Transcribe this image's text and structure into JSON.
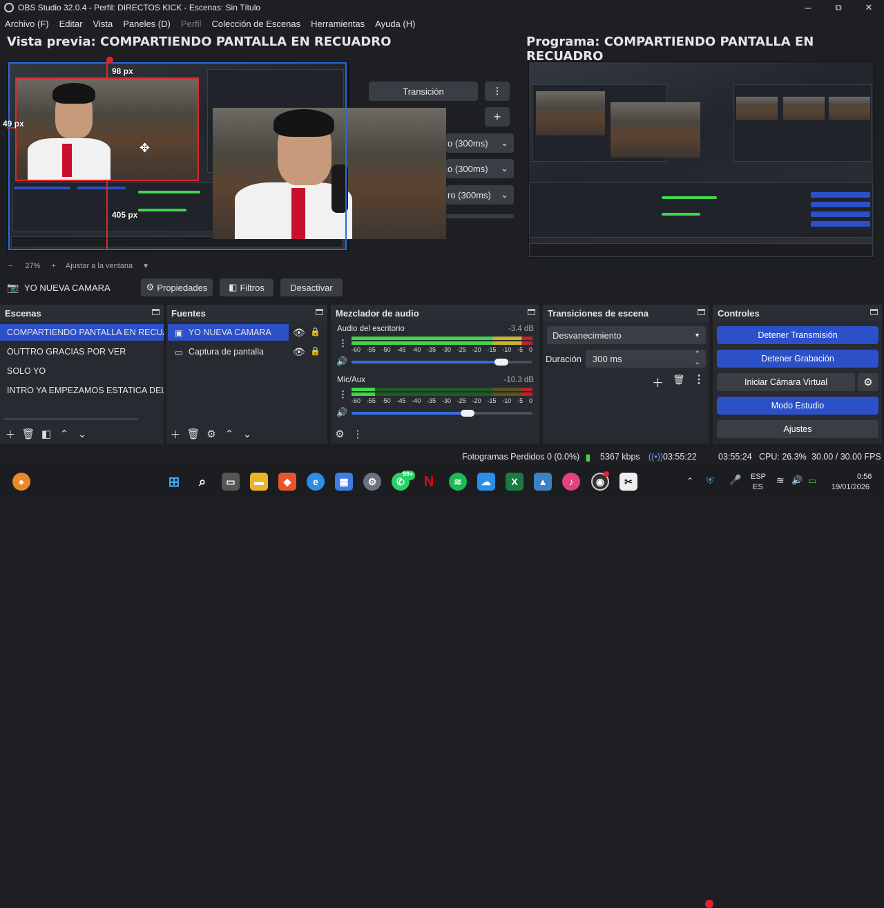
{
  "window": {
    "title": "OBS Studio 32.0.4 - Perfil: DIRECTOS KICK - Escenas: Sin Título",
    "minimize": "─",
    "maximize": "⧉",
    "close": "✕"
  },
  "menu": [
    "Archivo (F)",
    "Editar",
    "Vista",
    "Paneles (D)",
    "Perfil",
    "Colección de Escenas",
    "Herramientas",
    "Ayuda (H)"
  ],
  "preview": {
    "title": "Vista previa: COMPARTIENDO PANTALLA EN RECUADRO",
    "measure_top": "98 px",
    "measure_left": "49 px",
    "measure_bottom": "405 px",
    "zoom": "27%",
    "fit_label": "Ajustar a la ventana",
    "zoom_minus": "−",
    "zoom_plus": "+"
  },
  "program": {
    "title": "Programa: COMPARTIENDO PANTALLA EN RECUADRO"
  },
  "transition_panel": {
    "button": "Transición",
    "options": [
      "o (300ms)",
      "o (300ms)",
      "ro (300ms)"
    ]
  },
  "source_toolbar": {
    "source_name": "YO NUEVA CAMARA",
    "properties": "Propiedades",
    "filters": "Filtros",
    "deactivate": "Desactivar"
  },
  "scenes": {
    "title": "Escenas",
    "items": [
      "COMPARTIENDO PANTALLA EN RECUADRO",
      "OUTTRO GRACIAS POR VER",
      "SOLO YO",
      "INTRO YA EMPEZAMOS ESTATICA DEL CA"
    ],
    "selected": 0
  },
  "sources": {
    "title": "Fuentes",
    "items": [
      {
        "name": "YO NUEVA CAMARA",
        "icon": "camera-icon",
        "selected": true
      },
      {
        "name": "Captura de pantalla",
        "icon": "monitor-icon",
        "selected": false
      }
    ]
  },
  "mixer": {
    "title": "Mezclador de audio",
    "channels": [
      {
        "name": "Audio del escritorio",
        "db": "-3.4 dB",
        "level": 0.91,
        "volume": 0.83
      },
      {
        "name": "Mic/Aux",
        "db": "-10.3 dB",
        "level": 0.13,
        "volume": 0.64
      }
    ],
    "ticks": [
      "-60",
      "-55",
      "-50",
      "-45",
      "-40",
      "-35",
      "-30",
      "-25",
      "-20",
      "-15",
      "-10",
      "-5",
      "0"
    ]
  },
  "transitions": {
    "title": "Transiciones de escena",
    "selected": "Desvanecimiento",
    "duration_label": "Duración",
    "duration_value": "300 ms"
  },
  "controls": {
    "title": "Controles",
    "stop_stream": "Detener Transmisión",
    "stop_record": "Detener Grabación",
    "virtual_cam": "Iniciar Cámara Virtual",
    "studio_mode": "Modo Estudio",
    "settings": "Ajustes"
  },
  "status": {
    "dropped": "Fotogramas Perdidos 0 (0.0%)",
    "bitrate": "5367 kbps",
    "stream_time": "03:55:22",
    "rec_time": "03:55:24",
    "cpu": "CPU: 26.3%",
    "fps": "30.00 / 30.00 FPS"
  },
  "taskbar": {
    "whatsapp_badge": "99+",
    "language": "ESP",
    "language_sub": "ES",
    "time": "0:56",
    "date": "19/01/2026"
  },
  "colors": {
    "accent": "#2b50c8",
    "record": "#e0242b",
    "meter_green": "#3fd84a",
    "meter_yellow": "#c9b52b",
    "meter_red": "#c0202a"
  }
}
